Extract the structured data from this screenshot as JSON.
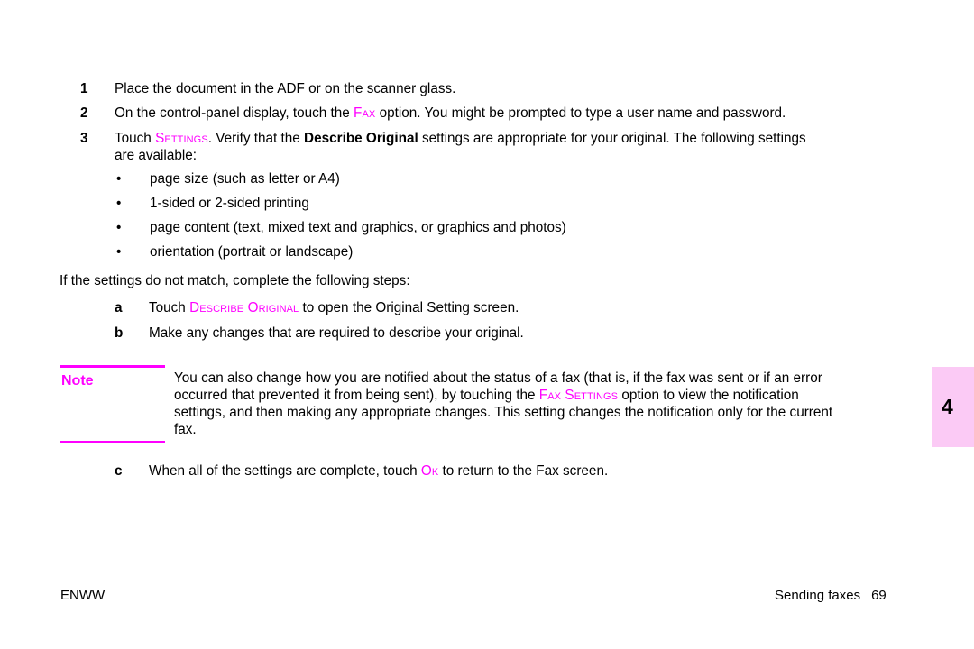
{
  "document": {
    "chapter_tab": "4",
    "accent_color": "#ff00ff",
    "tab_background_color": "#fbcaf5"
  },
  "steps": [
    {
      "marker": "1",
      "text": "Place the document in the ADF or on the scanner glass."
    },
    {
      "marker": "2",
      "text_before": "On the control-panel display, touch the ",
      "ui_control": "Fax",
      "text_after": " option. You might be prompted to type a user name and password."
    },
    {
      "marker": "3",
      "text_before": "Touch ",
      "ui_control": "Settings",
      "text_mid": ". Verify that the ",
      "bold_term": "Describe Original",
      "text_after": " settings are appropriate for your original. The following settings",
      "text_line2": "are available:"
    }
  ],
  "bullets": [
    {
      "bullet_char": "•",
      "text": "page size (such as letter or A4)"
    },
    {
      "bullet_char": "•",
      "text": "1-sided or 2-sided printing"
    },
    {
      "bullet_char": "•",
      "text": "page content (text, mixed text and graphics, or graphics and photos)"
    },
    {
      "bullet_char": "•",
      "text": "orientation (portrait or landscape)"
    }
  ],
  "continuation_paragraph": "If the settings do not match, complete the following steps:",
  "substeps": [
    {
      "marker": "a",
      "text_before": "Touch ",
      "ui_control": "Describe Original",
      "text_after": " to open the Original Setting screen."
    },
    {
      "marker": "b",
      "text_before": "Make any changes that are required to describe your original.",
      "ui_control": "",
      "text_after": ""
    },
    {
      "marker": "c",
      "text_before": "When all of the settings are complete, touch ",
      "ui_control": "Ok",
      "text_after": " to return to the Fax screen."
    }
  ],
  "note": {
    "label": "Note",
    "line1": "You can also change how you are notified about the status of a fax (that is, if the fax was sent or if an error",
    "line2_before": "occurred that prevented it from being sent), by touching the ",
    "line2_control": "Fax Settings",
    "line2_after": " option to view the notification",
    "line3": "settings, and then making any appropriate changes. This setting changes the notification only for the current",
    "line4": "fax."
  },
  "footer": {
    "left": "ENWW",
    "section": "Sending faxes",
    "page_number": "69"
  }
}
